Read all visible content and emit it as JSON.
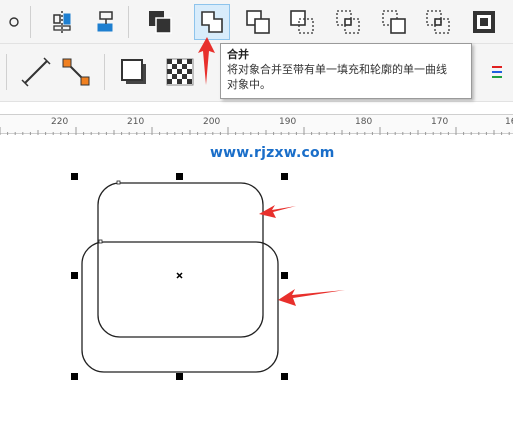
{
  "tooltip": {
    "title": "合并",
    "description_line1": "将对象合并至带有单一填充和轮廓的单一曲线",
    "description_line2": "对象中。"
  },
  "ruler": {
    "ticks": [
      "220",
      "210",
      "200",
      "190",
      "180",
      "170",
      "16"
    ]
  },
  "watermark": "www.rjzxw.com",
  "toolbar": {
    "shaping_icons": [
      "align-distribute-icon",
      "align-center-icon",
      "back-minus-front-icon",
      "combine-icon",
      "weld-icon",
      "trim-icon",
      "intersect-icon",
      "simplify-icon",
      "front-minus-back-icon",
      "boundary-icon"
    ],
    "active": "combine-icon"
  },
  "colors": {
    "accent": "#1a6ec9",
    "arrow": "#e8302c",
    "active_bg": "#d8ecfb"
  }
}
